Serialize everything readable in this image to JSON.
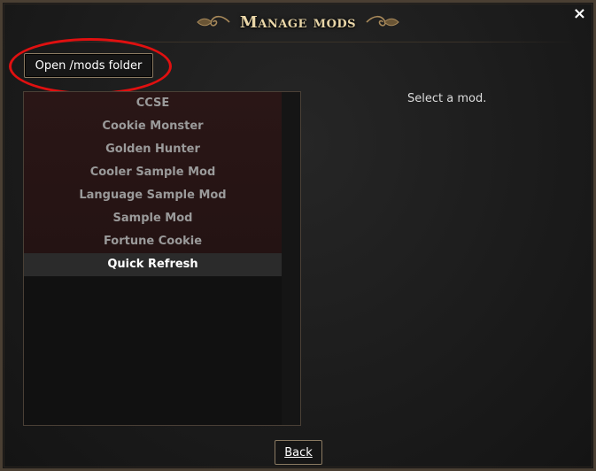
{
  "dialog": {
    "title": "Manage mods",
    "close_label": "×"
  },
  "toolbar": {
    "open_folder_label": "Open /mods folder"
  },
  "mod_list": {
    "items": [
      {
        "label": "CCSE"
      },
      {
        "label": "Cookie Monster"
      },
      {
        "label": "Golden Hunter"
      },
      {
        "label": "Cooler Sample Mod"
      },
      {
        "label": "Language Sample Mod"
      },
      {
        "label": "Sample Mod"
      },
      {
        "label": "Fortune Cookie"
      },
      {
        "label": "Quick Refresh"
      }
    ],
    "selected_index": 7
  },
  "detail": {
    "placeholder": "Select a mod."
  },
  "footer": {
    "back_label": "Back"
  },
  "colors": {
    "title_gold": "#e9d6a8",
    "button_border": "#8a7a62",
    "annotation_red": "#e01010",
    "enabled_mods_bg": "#2a1616"
  }
}
